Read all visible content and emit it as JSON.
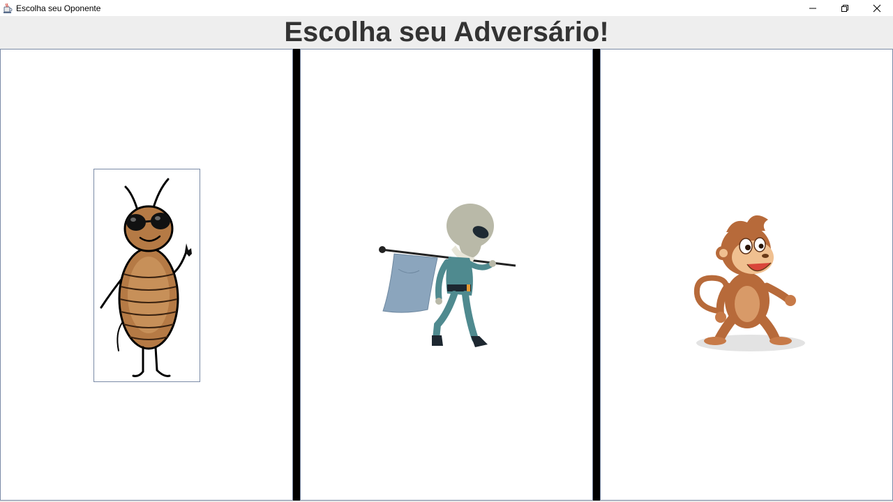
{
  "window": {
    "title": "Escolha seu Oponente",
    "icon": "java-cup-icon",
    "controls": [
      "minimize-icon",
      "restore-icon",
      "close-icon"
    ]
  },
  "header": {
    "title": "Escolha seu Adversário!"
  },
  "opponents": [
    {
      "icon": "cockroach-icon"
    },
    {
      "icon": "alien-icon"
    },
    {
      "icon": "monkey-icon"
    }
  ],
  "colors": {
    "header_bg": "#eeeeee",
    "heading_text": "#333333",
    "divider": "#000000",
    "panel_border": "#7a8aa6"
  }
}
